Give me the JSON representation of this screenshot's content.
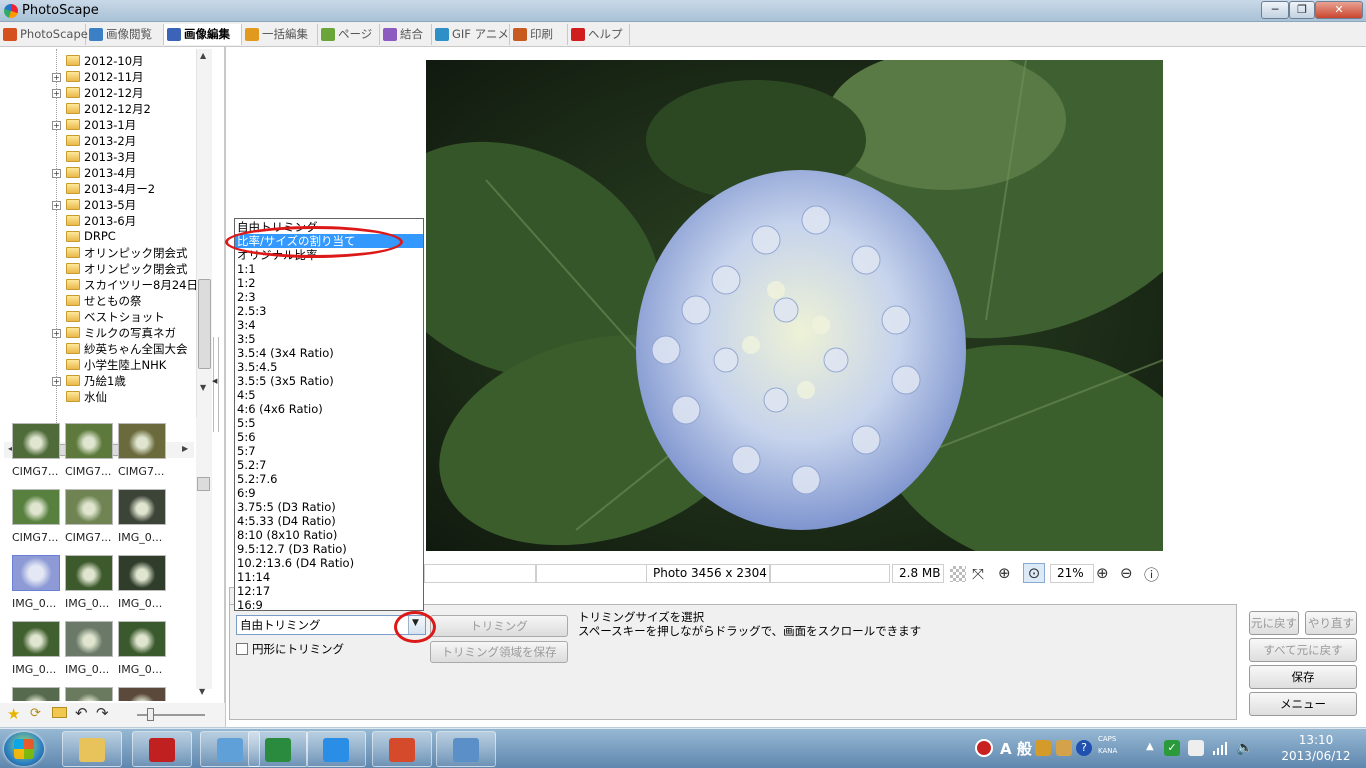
{
  "window": {
    "title": "PhotoScape",
    "controls": [
      "─",
      "❐",
      "✕"
    ]
  },
  "tabs": [
    {
      "label": "PhotoScape",
      "icon": "photoscape-icon",
      "color": "#d4501e"
    },
    {
      "label": "画像閲覧",
      "icon": "viewer-icon",
      "color": "#3b7fc4"
    },
    {
      "label": "画像編集",
      "icon": "editor-icon",
      "color": "#3b63b8",
      "active": true
    },
    {
      "label": "一括編集",
      "icon": "batch-icon",
      "color": "#e29a1e"
    },
    {
      "label": "ページ",
      "icon": "page-icon",
      "color": "#6aa53a"
    },
    {
      "label": "結合",
      "icon": "combine-icon",
      "color": "#8c5bc0"
    },
    {
      "label": "GIF アニメ",
      "icon": "gif-icon",
      "color": "#2f8fc7"
    },
    {
      "label": "印刷",
      "icon": "print-icon",
      "color": "#c75a1e"
    },
    {
      "label": "ヘルプ",
      "icon": "help-icon",
      "color": "#d01d1d"
    }
  ],
  "folder_tree": [
    {
      "label": "2012-10月",
      "expandable": false
    },
    {
      "label": "2012-11月",
      "expandable": true
    },
    {
      "label": "2012-12月",
      "expandable": true
    },
    {
      "label": "2012-12月2",
      "expandable": false
    },
    {
      "label": "2013-1月",
      "expandable": true
    },
    {
      "label": "2013-2月",
      "expandable": false
    },
    {
      "label": "2013-3月",
      "expandable": false
    },
    {
      "label": "2013-4月",
      "expandable": true
    },
    {
      "label": "2013-4月ー2",
      "expandable": false
    },
    {
      "label": "2013-5月",
      "expandable": true
    },
    {
      "label": "2013-6月",
      "expandable": false
    },
    {
      "label": "DRPC",
      "expandable": false
    },
    {
      "label": "オリンピック閉会式",
      "expandable": false
    },
    {
      "label": "オリンピック閉会式",
      "expandable": false
    },
    {
      "label": "スカイツリー8月24日",
      "expandable": false
    },
    {
      "label": "せともの祭",
      "expandable": false
    },
    {
      "label": "ベストショット",
      "expandable": false
    },
    {
      "label": "ミルクの写真ネガ",
      "expandable": true
    },
    {
      "label": "紗英ちゃん全国大会",
      "expandable": false
    },
    {
      "label": "小学生陸上NHK",
      "expandable": false
    },
    {
      "label": "乃絵1歳",
      "expandable": true
    },
    {
      "label": "水仙",
      "expandable": false
    }
  ],
  "thumbnails": [
    {
      "label": "CIMG7...",
      "color": "#4f6b3a"
    },
    {
      "label": "CIMG7...",
      "color": "#5d7a3c"
    },
    {
      "label": "CIMG7...",
      "color": "#6b6a3d"
    },
    {
      "label": "CIMG7...",
      "color": "#58803f"
    },
    {
      "label": "CIMG7...",
      "color": "#6f8452"
    },
    {
      "label": "IMG_0...",
      "color": "#3c4438"
    },
    {
      "label": "IMG_0...",
      "color": "#8d9ad6",
      "selected": true
    },
    {
      "label": "IMG_0...",
      "color": "#3d5a2c"
    },
    {
      "label": "IMG_0...",
      "color": "#2f3d2a"
    },
    {
      "label": "IMG_0...",
      "color": "#41602f"
    },
    {
      "label": "IMG_0...",
      "color": "#6b7a68"
    },
    {
      "label": "IMG_0...",
      "color": "#3a5a2d"
    },
    {
      "label": "",
      "color": "#566a4e"
    },
    {
      "label": "",
      "color": "#6a7a5e"
    },
    {
      "label": "",
      "color": "#5b4a3c"
    }
  ],
  "info": {
    "dimensions": "Photo 3456 x 2304",
    "filesize": "2.8 MB",
    "zoom": "21%"
  },
  "crop": {
    "selected": "自由トリミング",
    "trim_button": "トリミング",
    "save_region_button": "トリミング領域を保存",
    "circle_checkbox": "円形にトリミング",
    "hint_line1": "トリミングサイズを選択",
    "hint_line2": "スペースキーを押しながらドラッグで、画面をスクロールできます"
  },
  "crop_options": [
    "自由トリミング",
    "比率/サイズの割り当て",
    "オリジナル比率",
    "1:1",
    "1:2",
    "2:3",
    "2.5:3",
    "3:4",
    "3:5",
    "3.5:4 (3x4 Ratio)",
    "3.5:4.5",
    "3.5:5 (3x5 Ratio)",
    "4:5",
    "4:6 (4x6 Ratio)",
    "5:5",
    "5:6",
    "5:7",
    "5.2:7",
    "5.2:7.6",
    "6:9",
    "3.75:5 (D3 Ratio)",
    "4:5.33 (D4 Ratio)",
    "8:10 (8x10 Ratio)",
    "9.5:12.7 (D3 Ratio)",
    "10.2:13.6 (D4 Ratio)",
    "11:14",
    "12:17",
    "16:9"
  ],
  "crop_selected_index": 1,
  "right_buttons": {
    "undo": "元に戻す",
    "redo": "やり直す",
    "undo_all": "すべて元に戻す",
    "save": "保存",
    "menu": "メニュー"
  },
  "taskbar": {
    "apps": [
      {
        "name": "explorer-icon",
        "color": "#e8c25a"
      },
      {
        "name": "scissors-app-icon",
        "color": "#c02020"
      },
      {
        "name": "network-people-icon",
        "color": "#5fa0d8"
      },
      {
        "name": "excel-icon",
        "color": "#2a8a3e"
      },
      {
        "name": "ie-icon",
        "color": "#2b8ee6"
      },
      {
        "name": "photoscape-taskbar-icon",
        "color": "#d44a2a"
      },
      {
        "name": "remote-desktop-icon",
        "color": "#5a8fc8"
      }
    ],
    "ime": "A 般",
    "caps": "CAPS",
    "kana": "KANA",
    "time": "13:10",
    "date": "2013/06/12"
  }
}
